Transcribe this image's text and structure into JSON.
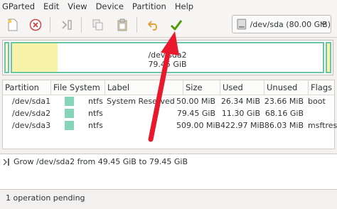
{
  "menu": [
    "GParted",
    "Edit",
    "View",
    "Device",
    "Partition",
    "Help"
  ],
  "toolbar": {
    "icons": [
      "new-partition-icon",
      "delete-icon",
      "resize-move-icon",
      "copy-icon",
      "paste-icon",
      "undo-icon",
      "apply-icon"
    ],
    "device_label": "/dev/sda (80.00 GiB)"
  },
  "disk_map": {
    "name": "/dev/sda2",
    "size": "79.45 GiB"
  },
  "table": {
    "headers": [
      "Partition",
      "File System",
      "Label",
      "Size",
      "Used",
      "Unused",
      "Flags"
    ],
    "rows": [
      [
        "/dev/sda1",
        "ntfs",
        "System Reserved",
        "50.00 MiB",
        "26.34 MiB",
        "23.66 MiB",
        "boot"
      ],
      [
        "/dev/sda2",
        "ntfs",
        "",
        "79.45 GiB",
        "11.30 GiB",
        "68.16 GiB",
        ""
      ],
      [
        "/dev/sda3",
        "ntfs",
        "",
        "509.00 MiB",
        "422.97 MiB",
        "86.03 MiB",
        "msftres"
      ]
    ]
  },
  "operations": [
    "Grow /dev/sda2 from 49.45 GiB to 79.45 GiB"
  ],
  "status": "1 operation pending",
  "colors": {
    "ntfs": "#87d5b9",
    "used": "#f7f4a9",
    "annotation_arrow": "#e8192c"
  }
}
